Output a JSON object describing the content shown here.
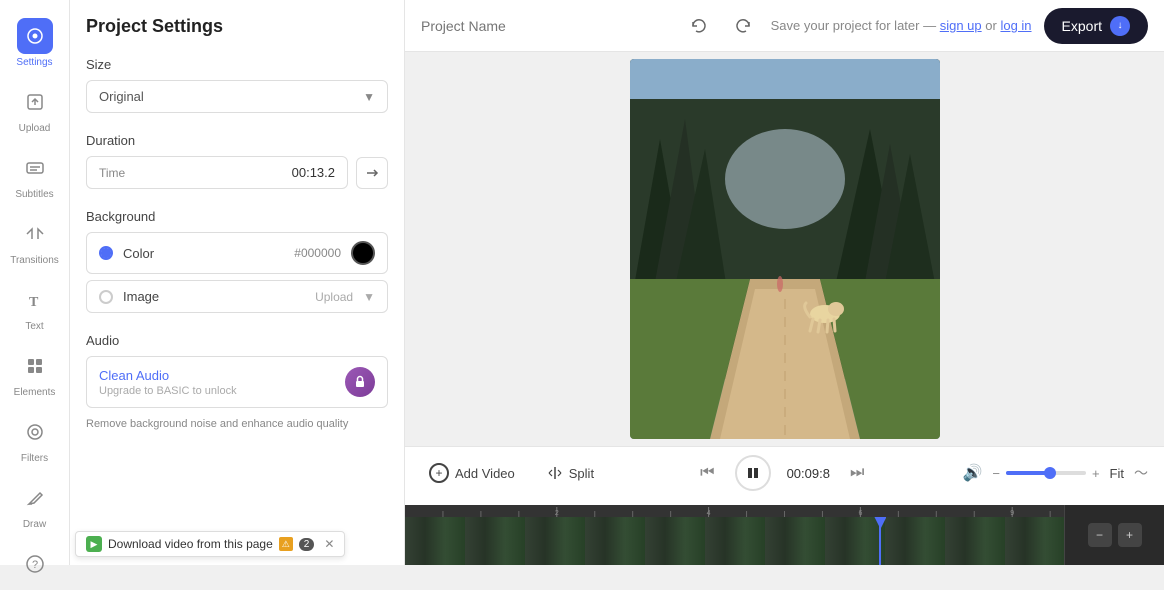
{
  "sidebar": {
    "items": [
      {
        "id": "settings",
        "label": "Settings",
        "active": true,
        "icon": "⚙"
      },
      {
        "id": "upload",
        "label": "Upload",
        "active": false,
        "icon": "↑"
      },
      {
        "id": "subtitles",
        "label": "Subtitles",
        "active": false,
        "icon": "CC"
      },
      {
        "id": "transitions",
        "label": "Transitions",
        "active": false,
        "icon": "⟷"
      },
      {
        "id": "text",
        "label": "Text",
        "active": false,
        "icon": "T"
      },
      {
        "id": "elements",
        "label": "Elements",
        "active": false,
        "icon": "◈"
      },
      {
        "id": "filters",
        "label": "Filters",
        "active": false,
        "icon": "◎"
      },
      {
        "id": "draw",
        "label": "Draw",
        "active": false,
        "icon": "✎"
      },
      {
        "id": "help",
        "label": "",
        "active": false,
        "icon": "?"
      }
    ]
  },
  "settings": {
    "title": "Project Settings",
    "size": {
      "label": "Size",
      "value": "Original"
    },
    "duration": {
      "label": "Duration",
      "type_label": "Time",
      "value": "00:13.2"
    },
    "background": {
      "label": "Background",
      "color_option": "Color",
      "color_value": "#000000",
      "image_option": "Image",
      "upload_label": "Upload"
    },
    "audio": {
      "label": "Audio",
      "clean_audio_label": "Clean Audio",
      "upgrade_label": "Upgrade to BASIC to unlock",
      "remove_bg_label": "Remove background noise and enhance audio quality"
    }
  },
  "topbar": {
    "project_name_placeholder": "Project Name",
    "save_text": "Save your project for later —",
    "sign_up_label": "sign up",
    "or_label": "or",
    "log_in_label": "log in",
    "export_label": "Export"
  },
  "playback": {
    "add_video_label": "Add Video",
    "split_label": "Split",
    "time_display": "00:09:8",
    "fit_label": "Fit"
  },
  "download_banner": {
    "text": "Download video from this page",
    "badge": "2"
  }
}
